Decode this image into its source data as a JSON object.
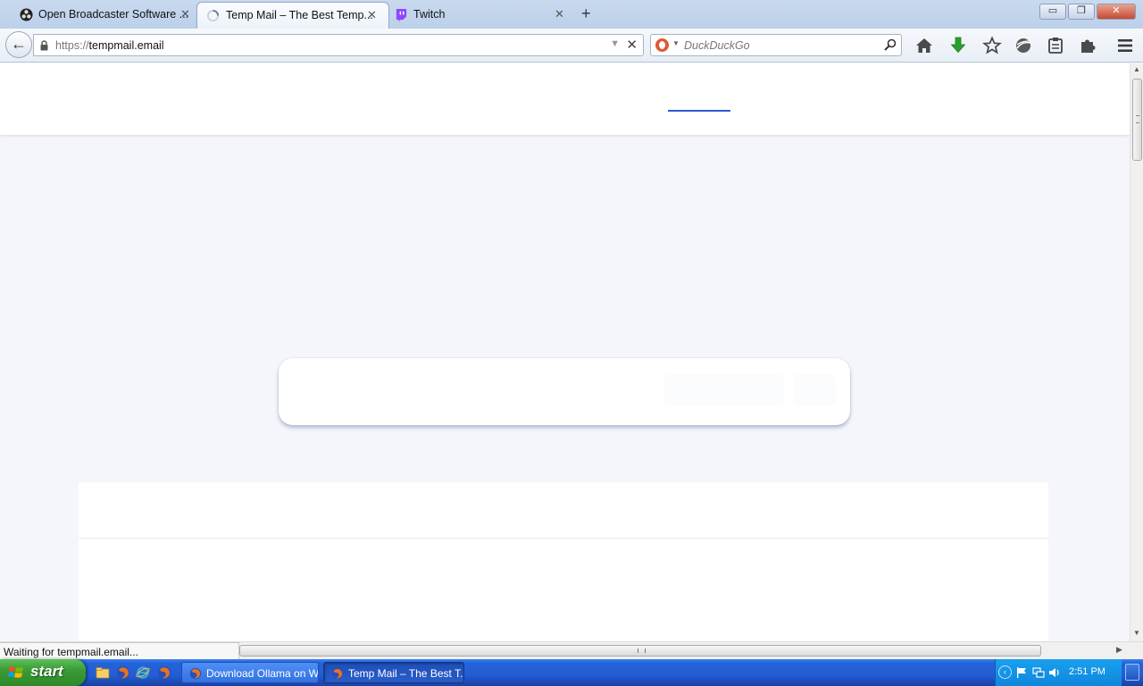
{
  "tabs": [
    {
      "label": "Open Broadcaster Software ...",
      "icon": "obs-icon"
    },
    {
      "label": "Temp Mail – The Best Temp...",
      "icon": "loading-spinner-icon"
    },
    {
      "label": "Twitch",
      "icon": "twitch-icon"
    }
  ],
  "new_tab_symbol": "+",
  "window_controls": {
    "minimize": "▭",
    "restore": "❐",
    "close": "✕"
  },
  "urlbar": {
    "scheme": "https://",
    "host": "tempmail.email"
  },
  "search": {
    "placeholder": "DuckDuckGo",
    "engine_icon": "duckduckgo-icon"
  },
  "toolbar_icons": [
    "home-icon",
    "download-icon",
    "bookmark-star-icon",
    "sync-icon",
    "reading-list-icon",
    "addons-puzzle-icon",
    "menu-hamburger-icon"
  ],
  "status": {
    "text": "Waiting for tempmail.email..."
  },
  "taskbar": {
    "start_label": "start",
    "quick_launch": [
      "explorer-icon",
      "firefox-icon",
      "ie-icon",
      "firefox-icon"
    ],
    "tasks": [
      {
        "label": "Download Ollama on W..."
      },
      {
        "label": "Temp Mail – The Best T..."
      }
    ],
    "clock": "2:51 PM"
  },
  "colors": {
    "accent_underline": "#2f5bd3",
    "page_background": "#f4f6fb",
    "taskbar_blue": "#245edb",
    "start_green": "#3a9c37",
    "download_green": "#2aa02a"
  }
}
